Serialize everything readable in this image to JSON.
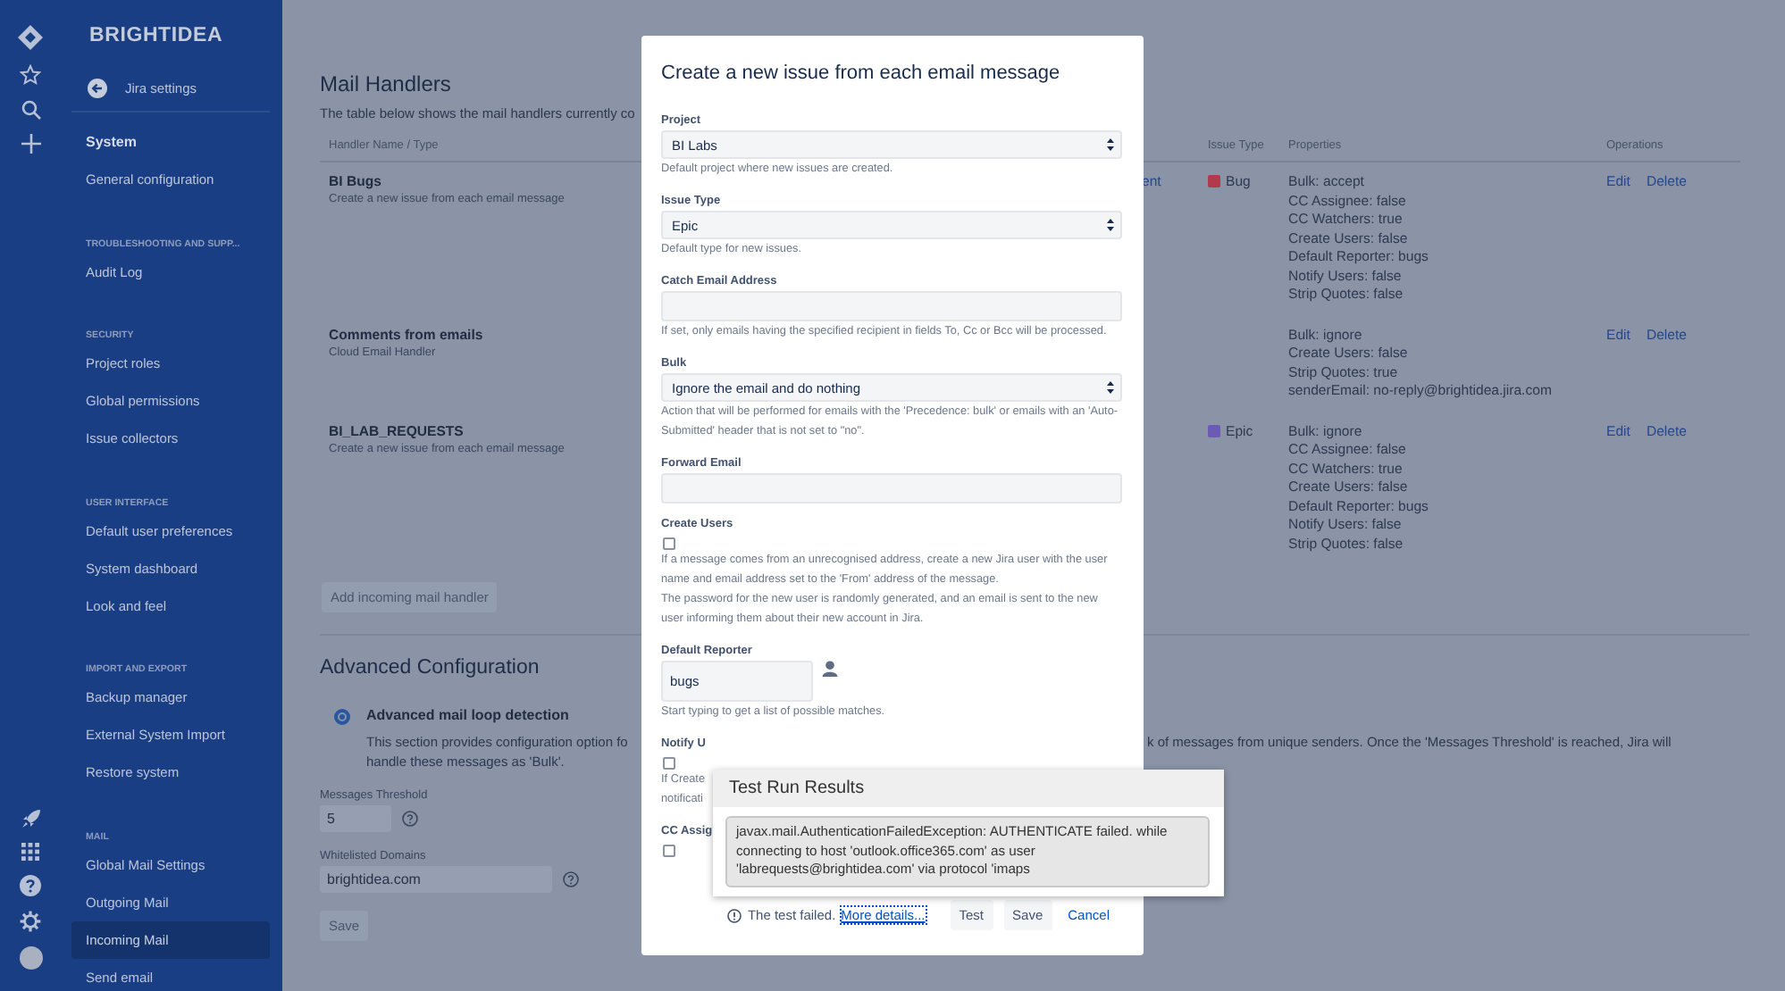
{
  "sidebar": {
    "logo": "BRIGHTIDEA",
    "back_label": "Jira settings",
    "category": "System",
    "sections": [
      {
        "items": [
          {
            "label": "General configuration",
            "selected": false
          }
        ]
      },
      {
        "heading": "TROUBLESHOOTING AND SUPP...",
        "items": [
          {
            "label": "Audit Log",
            "selected": false
          }
        ]
      },
      {
        "heading": "SECURITY",
        "items": [
          {
            "label": "Project roles",
            "selected": false
          },
          {
            "label": "Global permissions",
            "selected": false
          },
          {
            "label": "Issue collectors",
            "selected": false
          }
        ]
      },
      {
        "heading": "USER INTERFACE",
        "items": [
          {
            "label": "Default user preferences",
            "selected": false
          },
          {
            "label": "System dashboard",
            "selected": false
          },
          {
            "label": "Look and feel",
            "selected": false
          }
        ]
      },
      {
        "heading": "IMPORT AND EXPORT",
        "items": [
          {
            "label": "Backup manager",
            "selected": false
          },
          {
            "label": "External System Import",
            "selected": false
          },
          {
            "label": "Restore system",
            "selected": false
          }
        ]
      },
      {
        "heading": "MAIL",
        "items": [
          {
            "label": "Global Mail Settings",
            "selected": false
          },
          {
            "label": "Outgoing Mail",
            "selected": false
          },
          {
            "label": "Incoming Mail",
            "selected": true
          },
          {
            "label": "Send email",
            "selected": false
          }
        ]
      }
    ]
  },
  "main": {
    "title": "Mail Handlers",
    "description": "The table below shows the mail handlers currently co",
    "table": {
      "columns": [
        "Handler Name / Type",
        "Issue Type",
        "Properties",
        "Operations"
      ],
      "rows": [
        {
          "name": "BI Bugs",
          "type": "Create a new issue from each email message",
          "column_2": "ent",
          "issue_type": {
            "label": "Bug",
            "color": "#b03b4e"
          },
          "properties": [
            "Bulk: accept",
            "CC Assignee: false",
            "CC Watchers: true",
            "Create Users: false",
            "Default Reporter: bugs",
            "Notify Users: false",
            "Strip Quotes: false"
          ],
          "operations": [
            "Edit",
            "Delete"
          ]
        },
        {
          "name": "Comments from emails",
          "type": "Cloud Email Handler",
          "properties": [
            "Bulk: ignore",
            "Create Users: false",
            "Strip Quotes: true",
            "senderEmail: no-reply@brightidea.jira.com"
          ],
          "operations": [
            "Edit",
            "Delete"
          ]
        },
        {
          "name": "BI_LAB_REQUESTS",
          "type": "Create a new issue from each email message",
          "issue_type": {
            "label": "Epic",
            "color": "#6b5bb5"
          },
          "properties": [
            "Bulk: ignore",
            "CC Assignee: false",
            "CC Watchers: true",
            "Create Users: false",
            "Default Reporter: bugs",
            "Notify Users: false",
            "Strip Quotes: false"
          ],
          "operations": [
            "Edit",
            "Delete"
          ]
        }
      ]
    },
    "add_button": "Add incoming mail handler",
    "advanced": {
      "title": "Advanced Configuration",
      "option": {
        "label": "Advanced mail loop detection",
        "selected": true,
        "description_left": "This section provides configuration option fo",
        "description_right": "k of messages from unique senders. Once the 'Messages Threshold' is reached, Jira will",
        "description_line2": "handle these messages as 'Bulk'."
      },
      "fields": [
        {
          "label": "Messages Threshold",
          "value": "5",
          "kind": "short"
        },
        {
          "label": "Whitelisted Domains",
          "value": "brightidea.com",
          "kind": "long"
        }
      ],
      "save": "Save"
    }
  },
  "modal": {
    "title": "Create a new issue from each email message",
    "fields": [
      {
        "kind": "select",
        "label": "Project",
        "value": "BI Labs",
        "help": [
          "Default project where new issues are created."
        ]
      },
      {
        "kind": "select",
        "label": "Issue Type",
        "value": "Epic",
        "help": [
          "Default type for new issues."
        ]
      },
      {
        "kind": "text",
        "label": "Catch Email Address",
        "help": [
          "If set, only emails having the specified recipient in fields To, Cc or Bcc will be processed."
        ]
      },
      {
        "kind": "select",
        "label": "Bulk",
        "value": "Ignore the email and do nothing",
        "help": [
          "Action that will be performed for emails with the 'Precedence: bulk' or emails with an 'Auto-Submitted' header that is not set to \"no\"."
        ]
      },
      {
        "kind": "text",
        "label": "Forward Email"
      },
      {
        "kind": "checkbox",
        "label": "Create Users",
        "checked": false,
        "help": [
          "If a message comes from an unrecognised address, create a new Jira user with the user name and email address set to the 'From' address of the message.",
          "The password for the new user is randomly generated, and an email is sent to the new user informing them about their new account in Jira."
        ]
      },
      {
        "kind": "user",
        "label": "Default Reporter",
        "value": "bugs",
        "help": [
          "Start typing to get a list of possible matches."
        ]
      },
      {
        "kind": "checkbox",
        "label": "Notify U",
        "checked": false,
        "help": [
          "If Create",
          "notificati"
        ]
      },
      {
        "kind": "checkbox",
        "label": "CC Assig",
        "checked": false
      }
    ],
    "footer": {
      "status": "The test failed.",
      "link": "More details...",
      "buttons": [
        {
          "label": "Test",
          "kind": "button"
        },
        {
          "label": "Save",
          "kind": "button"
        },
        {
          "label": "Cancel",
          "kind": "link"
        }
      ]
    }
  },
  "popup": {
    "title": "Test Run Results",
    "message": "javax.mail.AuthenticationFailedException: AUTHENTICATE failed. while connecting to host 'outlook.office365.com' as user 'labrequests@brightidea.com' via protocol 'imaps"
  }
}
